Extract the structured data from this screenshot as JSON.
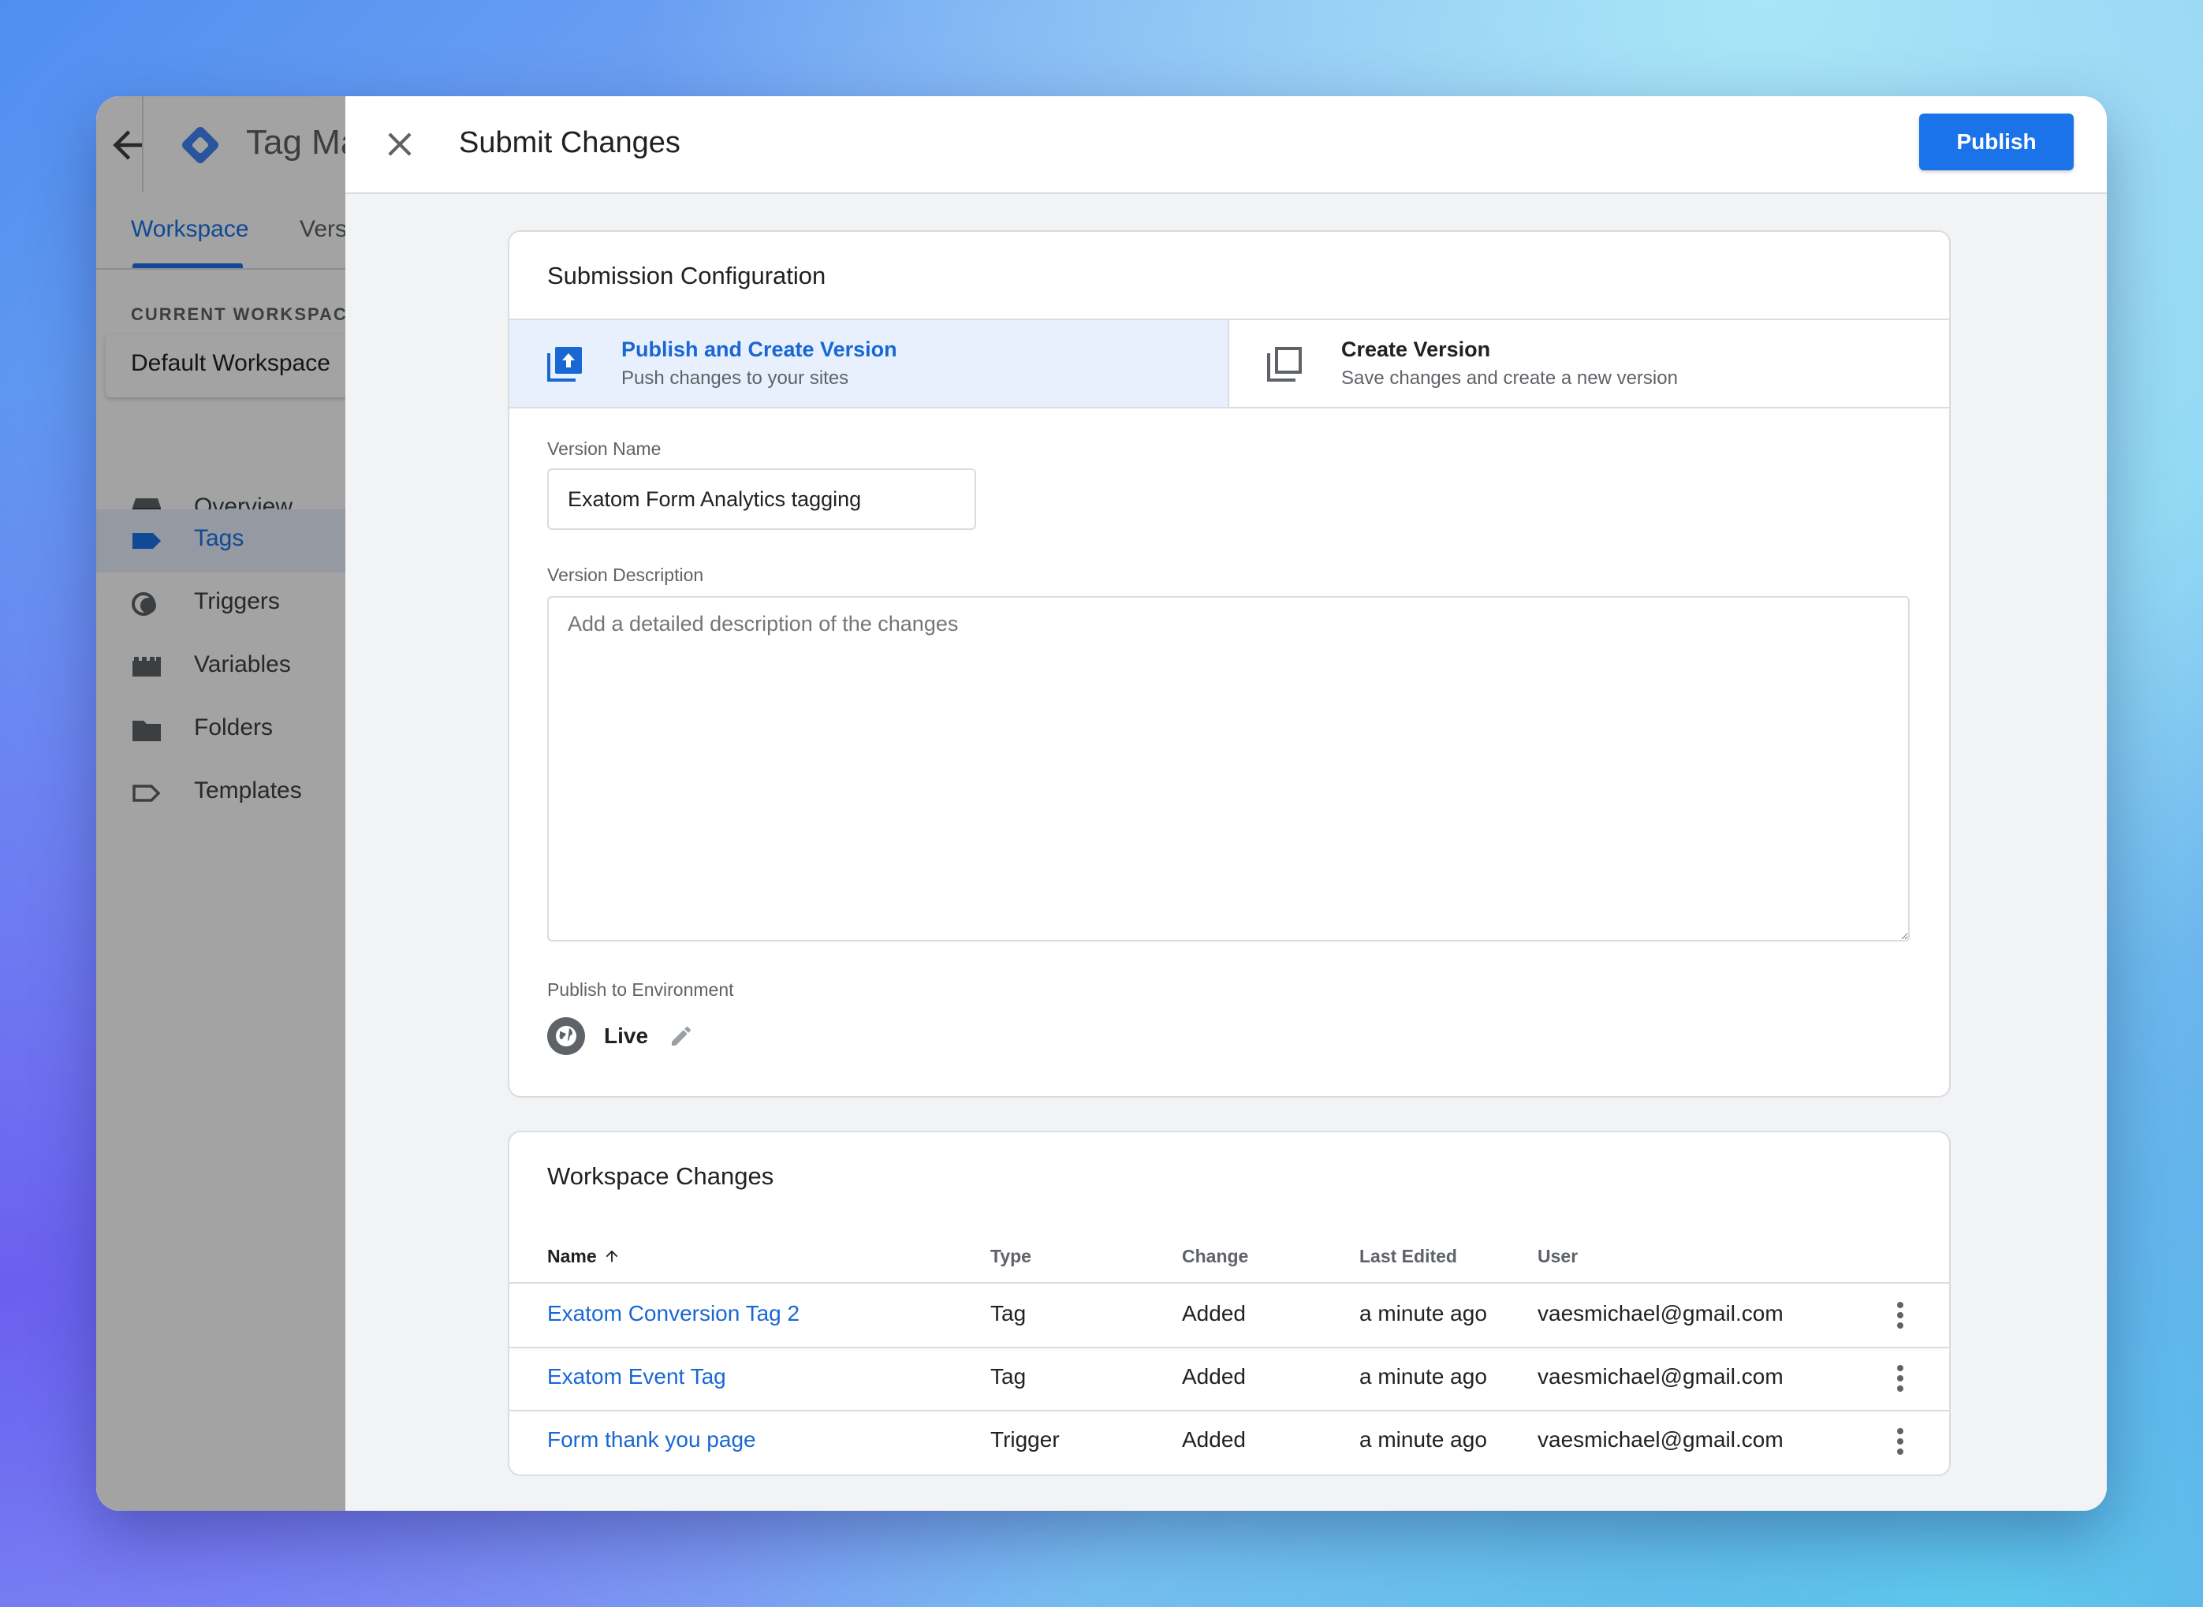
{
  "background_app": {
    "title": "Tag Ma",
    "tabs": [
      {
        "label": "Workspace"
      },
      {
        "label": "Vers"
      }
    ],
    "current_workspace_label": "CURRENT WORKSPACE",
    "current_workspace_value": "Default Workspace",
    "nav": [
      {
        "label": "Overview",
        "icon": "overview-icon"
      },
      {
        "label": "Tags",
        "icon": "tag-icon",
        "active": true
      },
      {
        "label": "Triggers",
        "icon": "trigger-icon"
      },
      {
        "label": "Variables",
        "icon": "variables-icon"
      },
      {
        "label": "Folders",
        "icon": "folder-icon"
      },
      {
        "label": "Templates",
        "icon": "template-icon"
      }
    ]
  },
  "panel": {
    "title": "Submit Changes",
    "publish_label": "Publish",
    "accent_color": "#1a73e8"
  },
  "submission": {
    "title": "Submission Configuration",
    "options": [
      {
        "title": "Publish and Create Version",
        "subtitle": "Push changes to your sites",
        "selected": true
      },
      {
        "title": "Create Version",
        "subtitle": "Save changes and create a new version",
        "selected": false
      }
    ],
    "version_name_label": "Version Name",
    "version_name_value": "Exatom Form Analytics tagging",
    "version_description_label": "Version Description",
    "version_description_placeholder": "Add a detailed description of the changes",
    "environment_label": "Publish to Environment",
    "environment_value": "Live"
  },
  "workspace_changes": {
    "title": "Workspace Changes",
    "columns": [
      "Name",
      "Type",
      "Change",
      "Last Edited",
      "User"
    ],
    "rows": [
      {
        "name": "Exatom Conversion Tag 2",
        "type": "Tag",
        "change": "Added",
        "last_edited": "a minute ago",
        "user": "vaesmichael@gmail.com"
      },
      {
        "name": "Exatom Event Tag",
        "type": "Tag",
        "change": "Added",
        "last_edited": "a minute ago",
        "user": "vaesmichael@gmail.com"
      },
      {
        "name": "Form thank you page",
        "type": "Trigger",
        "change": "Added",
        "last_edited": "a minute ago",
        "user": "vaesmichael@gmail.com"
      }
    ]
  }
}
